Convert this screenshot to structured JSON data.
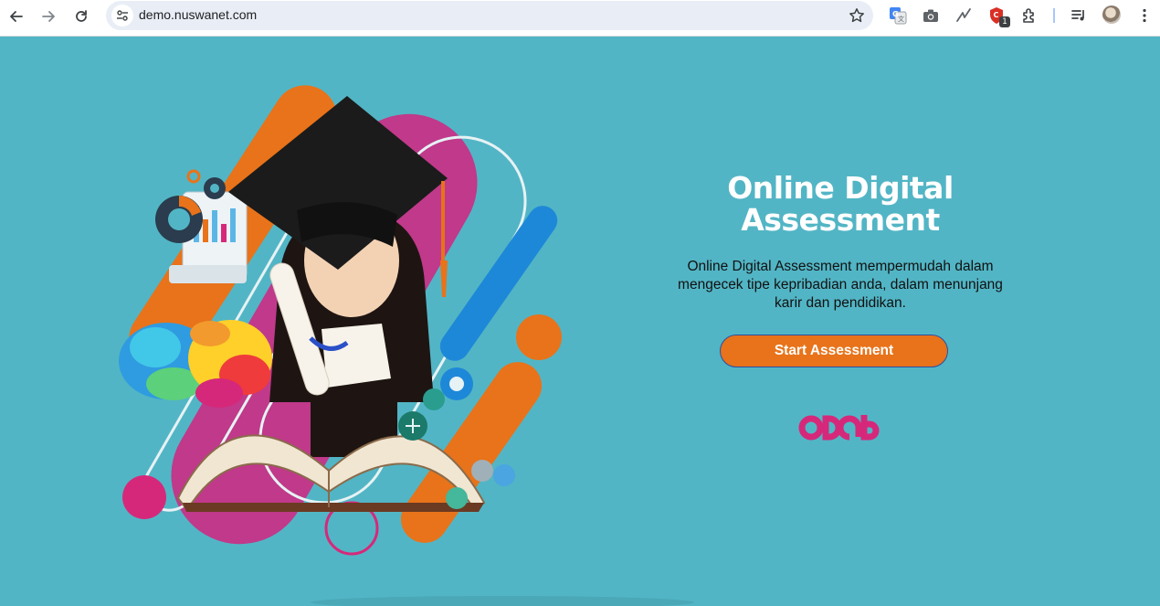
{
  "browser": {
    "url": "demo.nuswanet.com",
    "extension_badge": "1",
    "icons": [
      "back-arrow-icon",
      "forward-arrow-icon",
      "reload-icon",
      "site-settings-icon",
      "bookmark-star-icon",
      "google-translate-icon",
      "camera-icon",
      "stroke-extension-icon",
      "shield-extension-icon",
      "puzzle-extensions-icon",
      "media-controls-icon",
      "profile-avatar",
      "kebab-menu-icon"
    ]
  },
  "hero": {
    "title": "Online Digital Assessment",
    "description": "Online Digital Assessment mempermudah dalam mengecek tipe kepribadian anda, dalam menunjang karir dan pendidikan.",
    "cta_label": "Start Assessment"
  },
  "colors": {
    "background": "#52b5c5",
    "accent_orange": "#e8731a",
    "accent_magenta": "#c0398a",
    "accent_blue": "#1e88d8",
    "logo_pink": "#d6287a"
  }
}
